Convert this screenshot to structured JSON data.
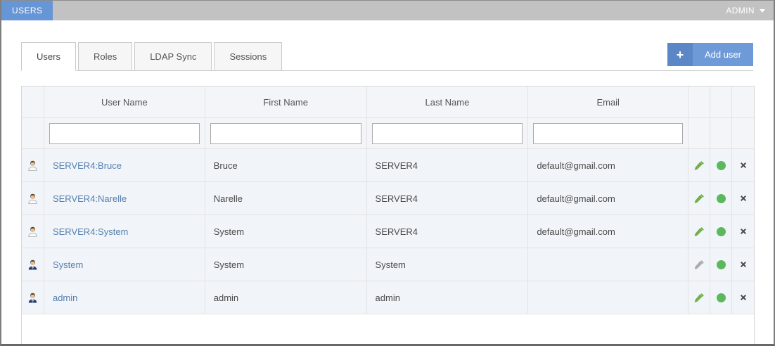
{
  "top_bar": {
    "module": "USERS",
    "user_menu": "ADMIN"
  },
  "tabs": [
    {
      "label": "Users",
      "active": true
    },
    {
      "label": "Roles",
      "active": false
    },
    {
      "label": "LDAP Sync",
      "active": false
    },
    {
      "label": "Sessions",
      "active": false
    }
  ],
  "toolbar": {
    "add_user_label": "Add user",
    "plus": "+"
  },
  "table": {
    "columns": [
      "User Name",
      "First Name",
      "Last Name",
      "Email"
    ],
    "filters": [
      {
        "value": "",
        "placeholder": ""
      },
      {
        "value": "",
        "placeholder": ""
      },
      {
        "value": "",
        "placeholder": ""
      },
      {
        "value": "",
        "placeholder": ""
      }
    ],
    "rows": [
      {
        "icon": "user-plain",
        "user_name": "SERVER4:Bruce",
        "first_name": "Bruce",
        "last_name": "SERVER4",
        "email": "default@gmail.com",
        "edit_enabled": true,
        "status": "active"
      },
      {
        "icon": "user-plain",
        "user_name": "SERVER4:Narelle",
        "first_name": "Narelle",
        "last_name": "SERVER4",
        "email": "default@gmail.com",
        "edit_enabled": true,
        "status": "active"
      },
      {
        "icon": "user-plain",
        "user_name": "SERVER4:System",
        "first_name": "System",
        "last_name": "SERVER4",
        "email": "default@gmail.com",
        "edit_enabled": true,
        "status": "active"
      },
      {
        "icon": "user-suit",
        "user_name": "System",
        "first_name": "System",
        "last_name": "System",
        "email": "",
        "edit_enabled": false,
        "status": "active"
      },
      {
        "icon": "user-suit",
        "user_name": "admin",
        "first_name": "admin",
        "last_name": "admin",
        "email": "",
        "edit_enabled": true,
        "status": "active"
      }
    ]
  },
  "icons": {
    "user_dropdown": "caret-down-icon",
    "add": "plus-icon",
    "row_type_plain": "user-icon",
    "row_type_suit": "user-suit-icon",
    "edit": "pencil-icon",
    "status": "green-dot-icon",
    "delete": "x-icon"
  },
  "colors": {
    "topbar_gray": "#c2c2c2",
    "module_blue": "#6796d6",
    "button_blue": "#6f9ad8",
    "button_blue_dark": "#5b87c7",
    "link_blue": "#5580b0",
    "pencil_green": "#72b046",
    "status_green": "#5cb85c",
    "row_bg": "#f1f4f8",
    "header_bg": "#f4f5f8"
  }
}
